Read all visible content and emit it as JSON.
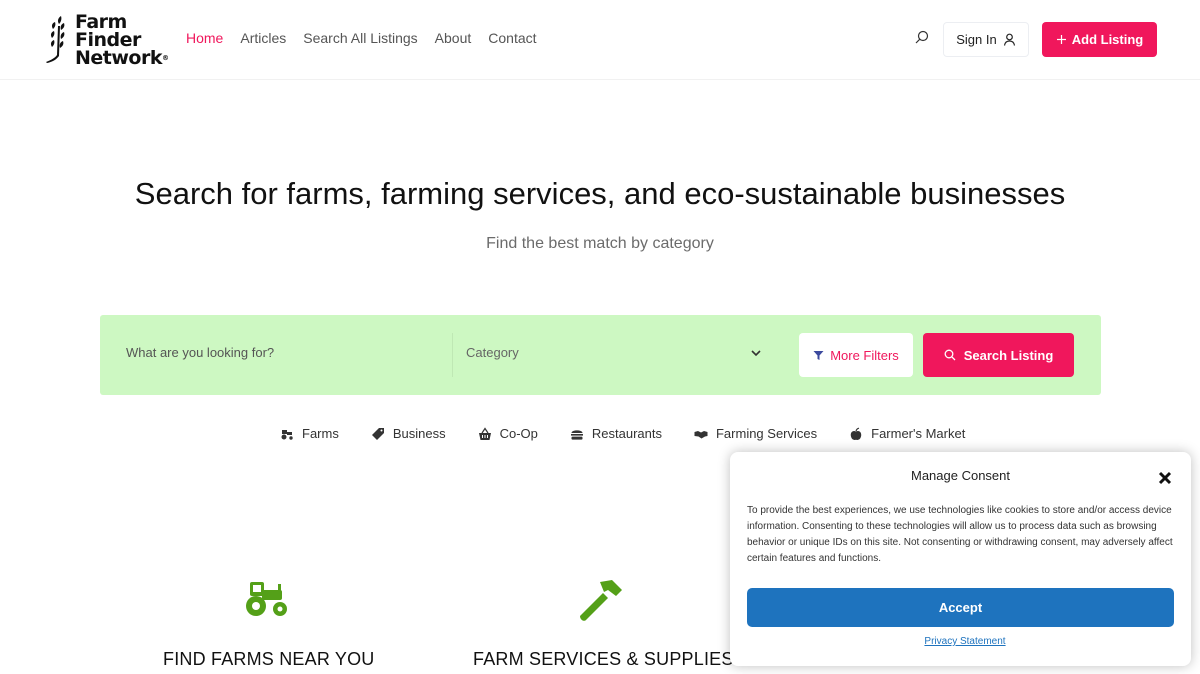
{
  "brand": {
    "logo_lines": [
      "Farm",
      "Finder",
      "Network"
    ],
    "logo_mark": "®",
    "accent_color": "#f0175c",
    "search_bg_color": "#cdf8c2",
    "icon_green": "#54a018"
  },
  "nav": {
    "items": [
      {
        "label": "Home",
        "active": true
      },
      {
        "label": "Articles",
        "active": false
      },
      {
        "label": "Search All Listings",
        "active": false
      },
      {
        "label": "About",
        "active": false
      },
      {
        "label": "Contact",
        "active": false
      }
    ]
  },
  "header_actions": {
    "sign_in_label": "Sign In",
    "add_listing_label": "Add Listing"
  },
  "hero": {
    "title": "Search for farms, farming services, and eco-sustainable businesses",
    "subtitle": "Find the best match by category"
  },
  "search": {
    "placeholder": "What are you looking for?",
    "category_label": "Category",
    "more_filters_label": "More Filters",
    "search_button_label": "Search Listing"
  },
  "categories": [
    {
      "label": "Farms",
      "icon": "tractor-icon"
    },
    {
      "label": "Business",
      "icon": "tag-icon"
    },
    {
      "label": "Co-Op",
      "icon": "basket-icon"
    },
    {
      "label": "Restaurants",
      "icon": "burger-icon"
    },
    {
      "label": "Farming Services",
      "icon": "handshake-icon"
    },
    {
      "label": "Farmer's Market",
      "icon": "apple-icon"
    }
  ],
  "features": [
    {
      "title": "FIND FARMS NEAR YOU",
      "icon": "tractor-icon"
    },
    {
      "title": "FARM SERVICES & SUPPLIES",
      "icon": "hammer-icon"
    }
  ],
  "consent": {
    "title": "Manage Consent",
    "text": "To provide the best experiences, we use technologies like cookies to store and/or access device information. Consenting to these technologies will allow us to process data such as browsing behavior or unique IDs on this site. Not consenting or withdrawing consent, may adversely affect certain features and functions.",
    "accept_label": "Accept",
    "privacy_label": "Privacy Statement",
    "accept_color": "#1e73be"
  }
}
